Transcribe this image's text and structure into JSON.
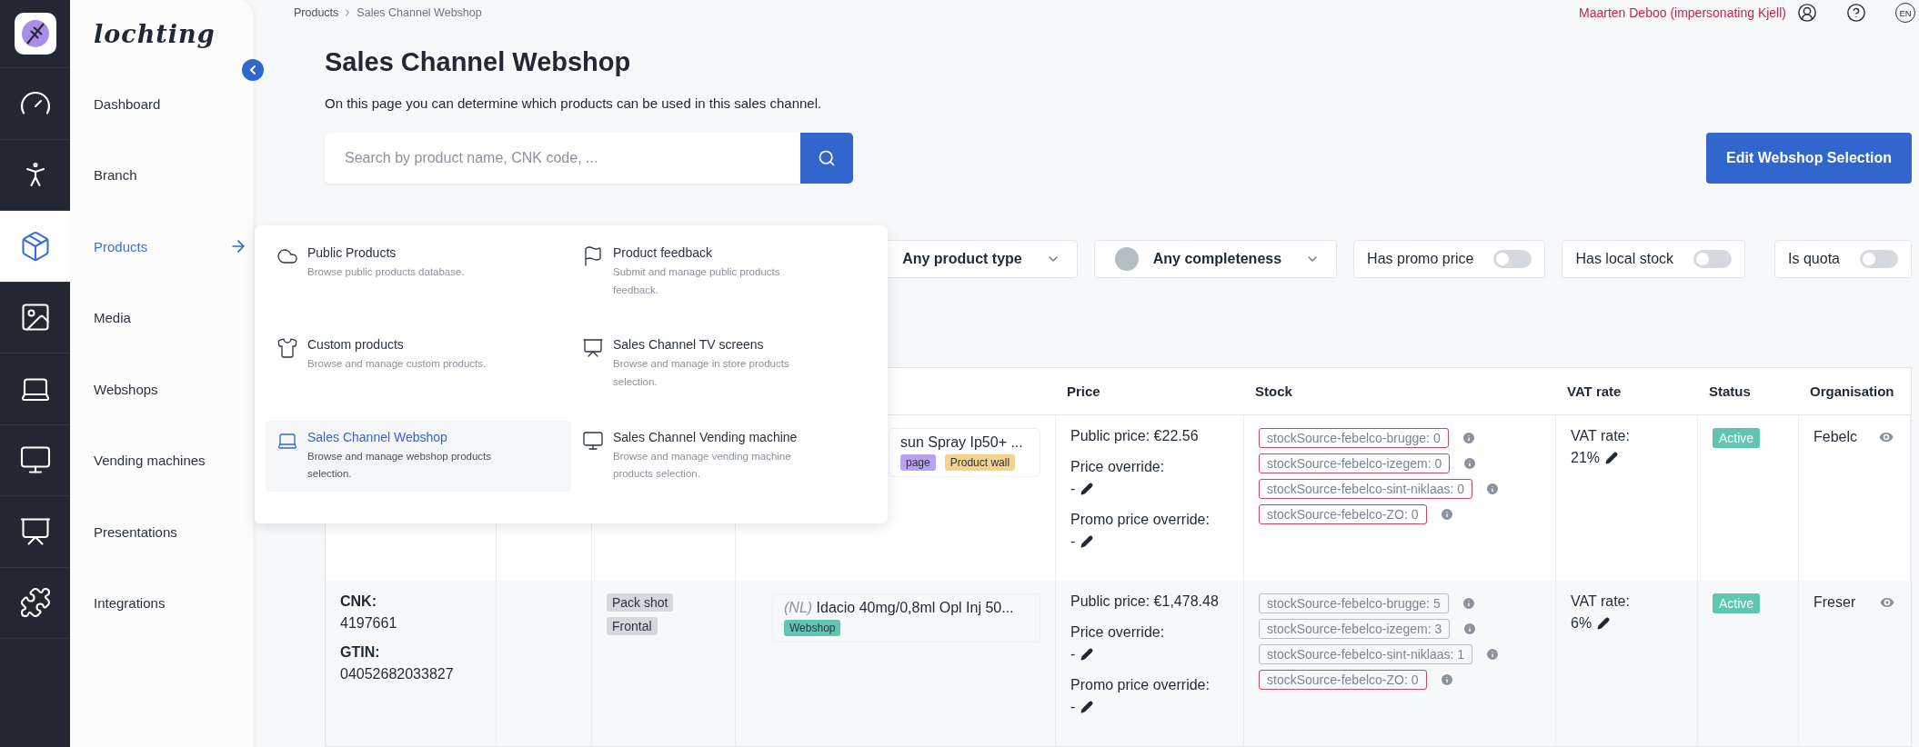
{
  "brand": {
    "wordmark": "lochting"
  },
  "navigation": [
    {
      "label": "Dashboard",
      "selected": false,
      "expanded": false
    },
    {
      "label": "Branch",
      "selected": false,
      "expanded": false
    },
    {
      "label": "Products",
      "selected": true,
      "expanded": true
    },
    {
      "label": "Media",
      "selected": false,
      "expanded": false
    },
    {
      "label": "Webshops",
      "selected": false,
      "expanded": false
    },
    {
      "label": "Vending machines",
      "selected": false,
      "expanded": false
    },
    {
      "label": "Presentations",
      "selected": false,
      "expanded": false
    },
    {
      "label": "Integrations",
      "selected": false,
      "expanded": false
    }
  ],
  "breadcrumb": [
    "Products",
    "Sales Channel Webshop"
  ],
  "user": {
    "name": "Maarten Deboo (impersonating Kjell)",
    "language": "EN"
  },
  "page": {
    "title": "Sales Channel Webshop",
    "description": "On this page you can determine which products can be used in this sales channel."
  },
  "search": {
    "placeholder": "Search by product name, CNK code, ..."
  },
  "edit_button": "Edit Webshop Selection",
  "products_menu": [
    {
      "title": "Public Products",
      "description": "Browse public products database.",
      "selected": false
    },
    {
      "title": "Product feedback",
      "description": "Submit and manage public products feedback.",
      "selected": false
    },
    {
      "title": "Custom products",
      "description": "Browse and manage custom products.",
      "selected": false
    },
    {
      "title": "Sales Channel TV screens",
      "description": "Browse and manage in store products selection.",
      "selected": false
    },
    {
      "title": "Sales Channel Webshop",
      "description": "Browse and manage webshop products selection.",
      "selected": true
    },
    {
      "title": "Sales Channel Vending machine",
      "description": "Browse and manage vending machine products selection.",
      "selected": false
    }
  ],
  "filters": [
    {
      "kind": "select",
      "label": "Any product type"
    },
    {
      "kind": "select",
      "label": "Any completeness",
      "color": "#b4bcc4"
    },
    {
      "kind": "toggle",
      "label": "Has promo price",
      "on": false
    },
    {
      "kind": "toggle",
      "label": "Has local stock",
      "on": false
    },
    {
      "kind": "toggle",
      "label": "Is quota",
      "on": false
    }
  ],
  "table": {
    "columns": [
      "Price",
      "Stock",
      "VAT rate",
      "Status",
      "Organisation"
    ],
    "rows": [
      {
        "product": {
          "name": "sun Spray Ip50+ ...",
          "tags": [
            {
              "label": "page",
              "color": "#b9a2ef"
            },
            {
              "label": "Product wall",
              "color": "#f4d38c"
            }
          ]
        },
        "public_price": "Public price: €22.56",
        "overrides": [
          {
            "label": "Price override:",
            "value": "-"
          },
          {
            "label": "Promo price override:",
            "value": "-"
          }
        ],
        "stock": [
          {
            "label": "stockSource-febelco-brugge: 0",
            "alert": true
          },
          {
            "label": "stockSource-febelco-izegem: 0",
            "alert": true
          },
          {
            "label": "stockSource-febelco-sint-niklaas: 0",
            "alert": true
          },
          {
            "label": "stockSource-febelco-ZO: 0",
            "alert": true
          }
        ],
        "vat": {
          "label": "VAT rate:",
          "value": "21%"
        },
        "status": "Active",
        "organisation": "Febelc"
      },
      {
        "codes": [
          {
            "label": "CNK:",
            "value": "4197661"
          },
          {
            "label": "GTIN:",
            "value": "04052682033827"
          }
        ],
        "images": [
          "Pack shot",
          "Frontal"
        ],
        "product": {
          "language": "(NL)",
          "name": "Idacio 40mg/0,8ml Opl Inj 50...",
          "tags": [
            {
              "label": "Webshop",
              "color": "#5fc6b2"
            }
          ]
        },
        "public_price": "Public price: €1,478.48",
        "overrides": [
          {
            "label": "Price override:",
            "value": "-"
          },
          {
            "label": "Promo price override:",
            "value": "-"
          }
        ],
        "stock": [
          {
            "label": "stockSource-febelco-brugge: 5",
            "alert": false
          },
          {
            "label": "stockSource-febelco-izegem: 3",
            "alert": false
          },
          {
            "label": "stockSource-febelco-sint-niklaas: 1",
            "alert": false
          },
          {
            "label": "stockSource-febelco-ZO: 0",
            "alert": true
          }
        ],
        "vat": {
          "label": "VAT rate:",
          "value": "6%"
        },
        "status": "Active",
        "organisation": "Freser"
      }
    ]
  }
}
